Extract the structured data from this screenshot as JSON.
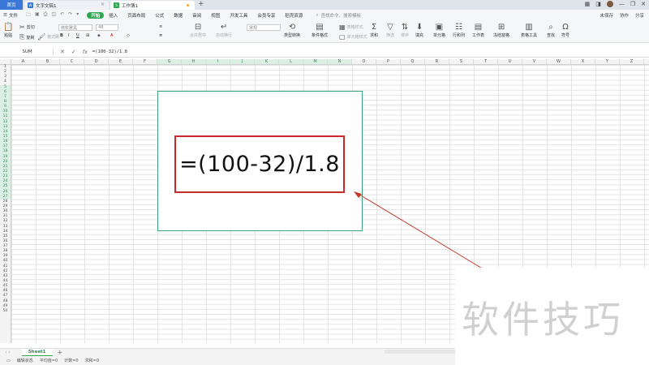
{
  "tabs": {
    "home": "首页",
    "doc": "文字文稿1",
    "book": "工作簿1",
    "new_tab": "+"
  },
  "window": {
    "minimize": "—",
    "restore": "❐",
    "close": "✕"
  },
  "menubar": {
    "file": "文件",
    "items": [
      "开始",
      "插入",
      "页面布局",
      "公式",
      "数据",
      "审阅",
      "视图",
      "开发工具",
      "会员专享",
      "稻壳资源"
    ],
    "active": "开始",
    "search": "查找命令、搜索模板",
    "right": [
      "未保存",
      "协作",
      "分享"
    ]
  },
  "ribbon": {
    "paste": "粘贴",
    "cut": "剪切",
    "copy": "复制",
    "format_painter": "格式刷",
    "font_name": "微软雅黑",
    "font_size": "48",
    "merge_center": "合并居中",
    "wrap_text": "自动换行",
    "number_format": "常规",
    "type_convert": "类型转换",
    "conditional_format": "条件格式",
    "table_style": "表格样式",
    "cell_style": "单元格样式",
    "sum": "求和",
    "filter": "筛选",
    "sort": "排序",
    "fill": "填充",
    "cells": "单元格",
    "row_col": "行和列",
    "worksheet": "工作表",
    "freeze": "冻结窗格",
    "table_tools": "表格工具",
    "find": "查找",
    "symbol": "符号"
  },
  "formula_bar": {
    "name_box": "SUM",
    "cancel": "✕",
    "confirm": "✓",
    "fx": "fx",
    "formula": "=(100-32)/1.8"
  },
  "grid": {
    "columns": [
      "A",
      "B",
      "C",
      "D",
      "E",
      "F",
      "G",
      "H",
      "I",
      "J",
      "K",
      "L",
      "M",
      "N",
      "O",
      "P",
      "Q",
      "R",
      "S",
      "T",
      "U",
      "V",
      "W",
      "X",
      "Y",
      "Z"
    ],
    "highlighted_columns": [
      "G",
      "H",
      "I",
      "J",
      "K",
      "L",
      "M",
      "N"
    ],
    "row_count": 50,
    "highlighted_rows_from": 5,
    "highlighted_rows_to": 27
  },
  "zoom_callout": {
    "formula": "=(100-32)/1.8",
    "accent": "#c92a2a",
    "border": "#3aa57a"
  },
  "watermark": "软件技巧",
  "sheet_tabs": {
    "nav": "‹ ›",
    "active": "Sheet1",
    "add": "+"
  },
  "status_bar": {
    "mode": "编辑状态",
    "average": "平均值=0",
    "count": "计数=0",
    "sum": "求和=0"
  },
  "colors": {
    "accent_green": "#2fa84f",
    "home_tab": "#3a78d8",
    "arrow": "#c0392b"
  }
}
